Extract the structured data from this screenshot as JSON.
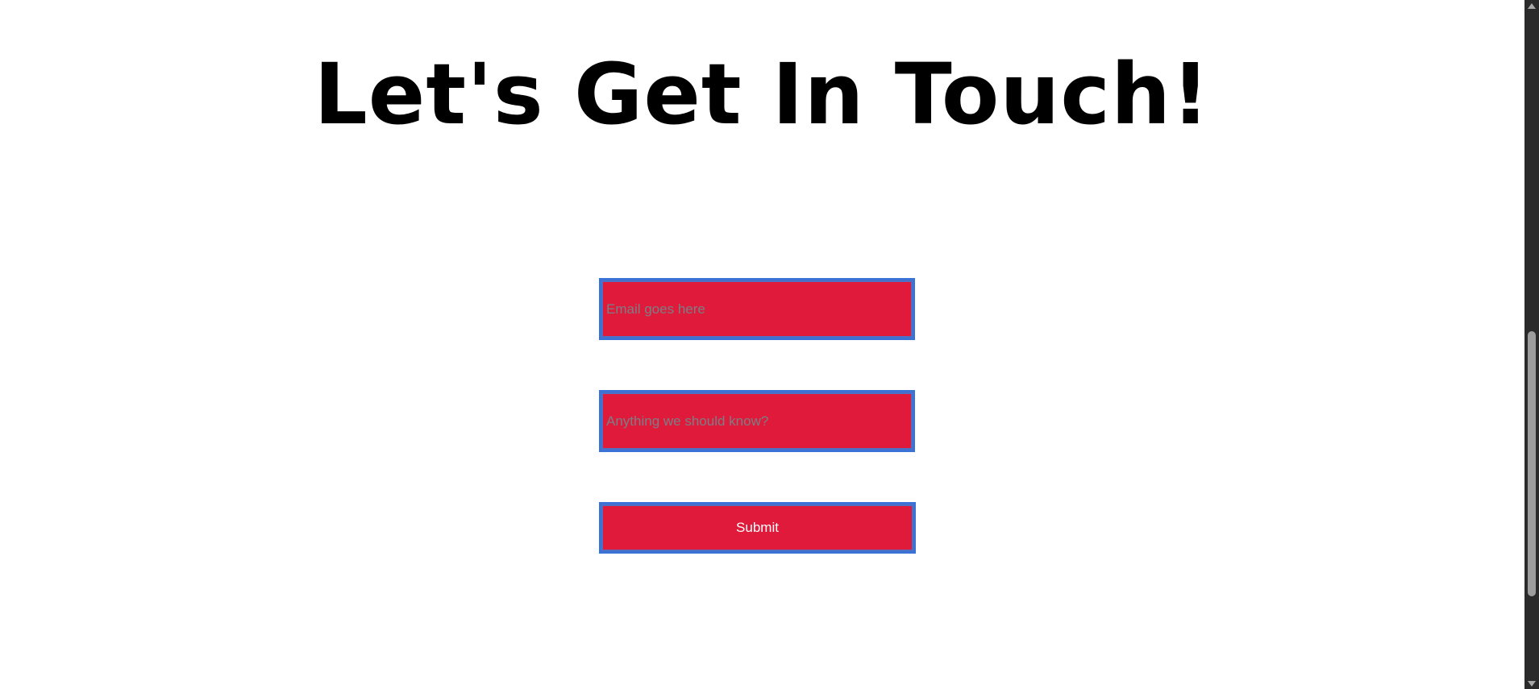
{
  "page": {
    "title": "Let's Get In Touch!"
  },
  "form": {
    "email": {
      "placeholder": "Email goes here",
      "value": ""
    },
    "message": {
      "placeholder": "Anything we should know?",
      "value": ""
    },
    "submit_label": "Submit"
  },
  "colors": {
    "field_background": "#e01a3b",
    "field_border": "#3a72d6",
    "title_text": "#000000",
    "placeholder_text": "#7a7f86",
    "page_background": "#ffffff",
    "scrollbar_track": "#2b2b2b",
    "scrollbar_thumb": "#9e9e9e"
  },
  "icons": {
    "scroll_up": "scroll-up-arrow-icon",
    "scroll_down": "scroll-down-arrow-icon"
  }
}
